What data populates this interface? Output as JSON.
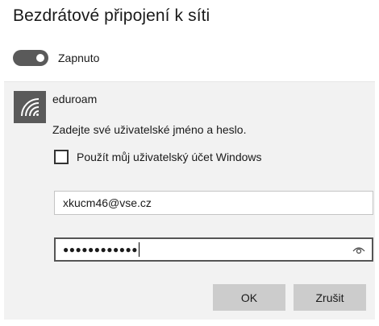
{
  "header": {
    "title": "Bezdrátové připojení k síti"
  },
  "wifi_toggle": {
    "state": "on",
    "label": "Zapnuto"
  },
  "network": {
    "name": "eduroam",
    "icon": "wifi-signal-icon",
    "prompt": "Zadejte své uživatelské jméno a heslo.",
    "use_windows_account": {
      "label": "Použít můj uživatelský účet Windows",
      "checked": false
    },
    "username": {
      "value": "xkucm46@vse.cz"
    },
    "password": {
      "masked_value": "●●●●●●●●●●●●",
      "reveal_icon": "eye-icon"
    },
    "buttons": {
      "ok_label": "OK",
      "cancel_label": "Zrušit"
    }
  },
  "colors": {
    "panel_bg": "#f2f2f2",
    "toggle_on": "#5a5a5a",
    "button_bg": "#cccccc"
  }
}
